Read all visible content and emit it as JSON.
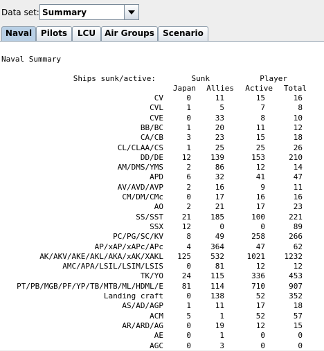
{
  "dataset": {
    "label": "Data set:",
    "value": "Summary"
  },
  "tabs": [
    {
      "label": "Naval"
    },
    {
      "label": "Pilots"
    },
    {
      "label": "LCU"
    },
    {
      "label": "Air Groups"
    },
    {
      "label": "Scenario"
    }
  ],
  "report": {
    "title": "Naval Summary",
    "header_left": "Ships sunk/active:",
    "header_sunk": "Sunk",
    "header_player": "Player",
    "col_japan": "Japan",
    "col_allies": "Allies",
    "col_active": "Active",
    "col_total": "Total",
    "rows": [
      {
        "name": "CV",
        "japan": "0",
        "allies": "11",
        "active": "15",
        "total": "16"
      },
      {
        "name": "CVL",
        "japan": "1",
        "allies": "5",
        "active": "7",
        "total": "8"
      },
      {
        "name": "CVE",
        "japan": "0",
        "allies": "33",
        "active": "8",
        "total": "10"
      },
      {
        "name": "BB/BC",
        "japan": "1",
        "allies": "20",
        "active": "11",
        "total": "12"
      },
      {
        "name": "CA/CB",
        "japan": "3",
        "allies": "23",
        "active": "15",
        "total": "18"
      },
      {
        "name": "CL/CLAA/CS",
        "japan": "1",
        "allies": "25",
        "active": "25",
        "total": "26"
      },
      {
        "name": "DD/DE",
        "japan": "12",
        "allies": "139",
        "active": "153",
        "total": "210"
      },
      {
        "name": "AM/DMS/YMS",
        "japan": "2",
        "allies": "86",
        "active": "12",
        "total": "14"
      },
      {
        "name": "APD",
        "japan": "6",
        "allies": "32",
        "active": "41",
        "total": "47"
      },
      {
        "name": "AV/AVD/AVP",
        "japan": "2",
        "allies": "16",
        "active": "9",
        "total": "11"
      },
      {
        "name": "CM/DM/CMc",
        "japan": "0",
        "allies": "17",
        "active": "16",
        "total": "16"
      },
      {
        "name": "AO",
        "japan": "2",
        "allies": "21",
        "active": "17",
        "total": "23"
      },
      {
        "name": "SS/SST",
        "japan": "21",
        "allies": "185",
        "active": "100",
        "total": "221"
      },
      {
        "name": "SSX",
        "japan": "12",
        "allies": "0",
        "active": "0",
        "total": "89"
      },
      {
        "name": "PC/PG/SC/KV",
        "japan": "8",
        "allies": "49",
        "active": "258",
        "total": "266"
      },
      {
        "name": "AP/xAP/xAPc/APc",
        "japan": "4",
        "allies": "364",
        "active": "47",
        "total": "62"
      },
      {
        "name": "AK/AKV/AKE/AKL/AKA/xAK/XAKL",
        "japan": "125",
        "allies": "532",
        "active": "1021",
        "total": "1232"
      },
      {
        "name": "AMC/APA/LSIL/LSIM/LSIS",
        "japan": "0",
        "allies": "81",
        "active": "12",
        "total": "12"
      },
      {
        "name": "TK/YO",
        "japan": "24",
        "allies": "115",
        "active": "336",
        "total": "453"
      },
      {
        "name": "PT/PB/MGB/PF/YP/TB/MTB/ML/HDML/E",
        "japan": "81",
        "allies": "114",
        "active": "710",
        "total": "907"
      },
      {
        "name": "Landing craft",
        "japan": "0",
        "allies": "138",
        "active": "52",
        "total": "352"
      },
      {
        "name": "AS/AD/AGP",
        "japan": "1",
        "allies": "11",
        "active": "17",
        "total": "18"
      },
      {
        "name": "ACM",
        "japan": "5",
        "allies": "1",
        "active": "52",
        "total": "57"
      },
      {
        "name": "AR/ARD/AG",
        "japan": "0",
        "allies": "19",
        "active": "12",
        "total": "15"
      },
      {
        "name": "AE",
        "japan": "0",
        "allies": "1",
        "active": "0",
        "total": "0"
      },
      {
        "name": "AGC",
        "japan": "0",
        "allies": "3",
        "active": "0",
        "total": "0"
      }
    ]
  }
}
